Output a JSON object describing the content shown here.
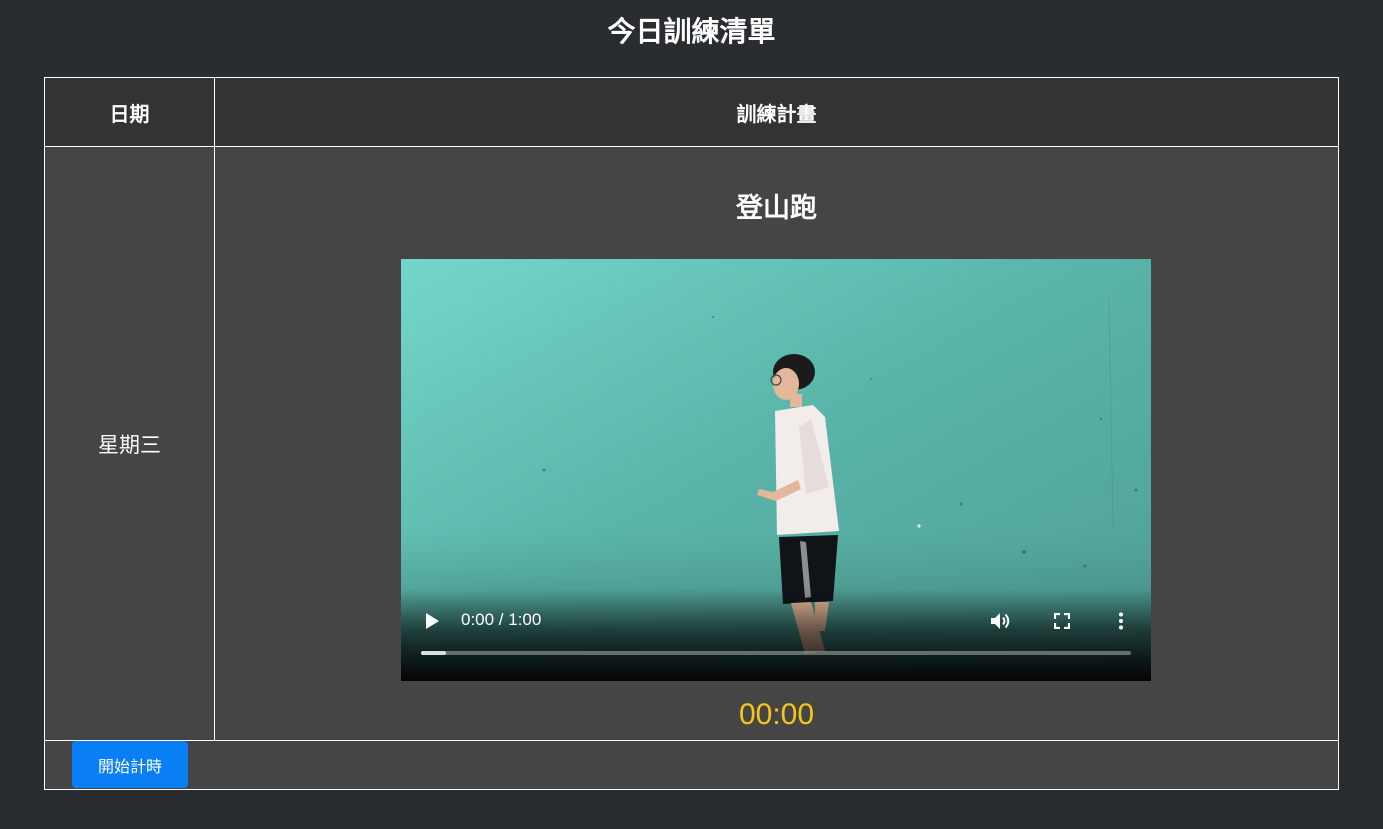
{
  "page": {
    "title": "今日訓練清單"
  },
  "table": {
    "headers": {
      "date": "日期",
      "plan": "訓練計畫"
    },
    "row": {
      "date": "星期三",
      "exercise": "登山跑",
      "video": {
        "current_time": "0:00",
        "duration": "1:00",
        "time_label": "0:00 / 1:00",
        "progress_fraction": 0.035,
        "controls": [
          "play-icon",
          "volume-icon",
          "fullscreen-icon",
          "more-options-icon"
        ]
      },
      "timer": "00:00"
    },
    "footer": {
      "start_button_label": "開始計時"
    }
  },
  "colors": {
    "background": "#2a2d2f",
    "header_bg": "#333333",
    "cell_bg": "#454545",
    "timer": "#f5c518",
    "button": "#0a7ff5",
    "video_wall": "#5fb8ad"
  }
}
